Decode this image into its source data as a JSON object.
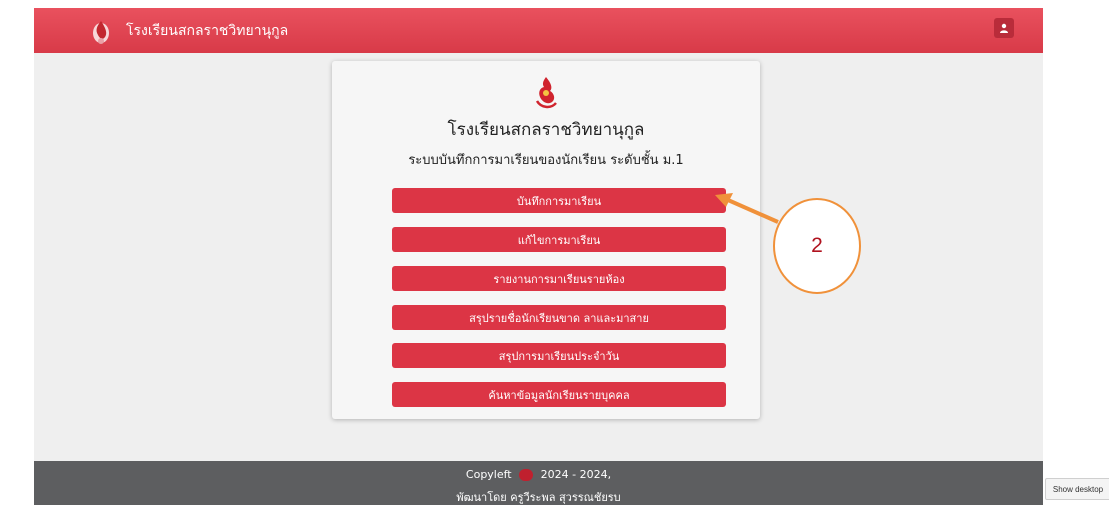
{
  "navbar": {
    "brand": "โรงเรียนสกลราชวิทยานุกูล",
    "user_icon": "user-icon"
  },
  "card": {
    "school_name": "โรงเรียนสกลราชวิทยานุกูล",
    "subtitle": "ระบบบันทึกการมาเรียนของนักเรียน ระดับชั้น ม.1",
    "menu": [
      {
        "label": "บันทึกการมาเรียน"
      },
      {
        "label": "แก้ไขการมาเรียน"
      },
      {
        "label": "รายงานการมาเรียนรายห้อง"
      },
      {
        "label": "สรุปรายชื่อนักเรียนขาด ลาและมาสาย"
      },
      {
        "label": "สรุปการมาเรียนประจำวัน"
      },
      {
        "label": "ค้นหาข้อมูลนักเรียนรายบุคคล"
      }
    ]
  },
  "footer": {
    "copyleft": "Copyleft",
    "years": "2024 - 2024,",
    "developer": "พัฒนาโดย ครูวีระพล สุวรรณชัยรบ"
  },
  "annotation": {
    "number": "2"
  },
  "taskbar": {
    "show_desktop": "Show desktop"
  },
  "colors": {
    "brand_red": "#dc3545",
    "callout_orange": "#f0913a"
  }
}
